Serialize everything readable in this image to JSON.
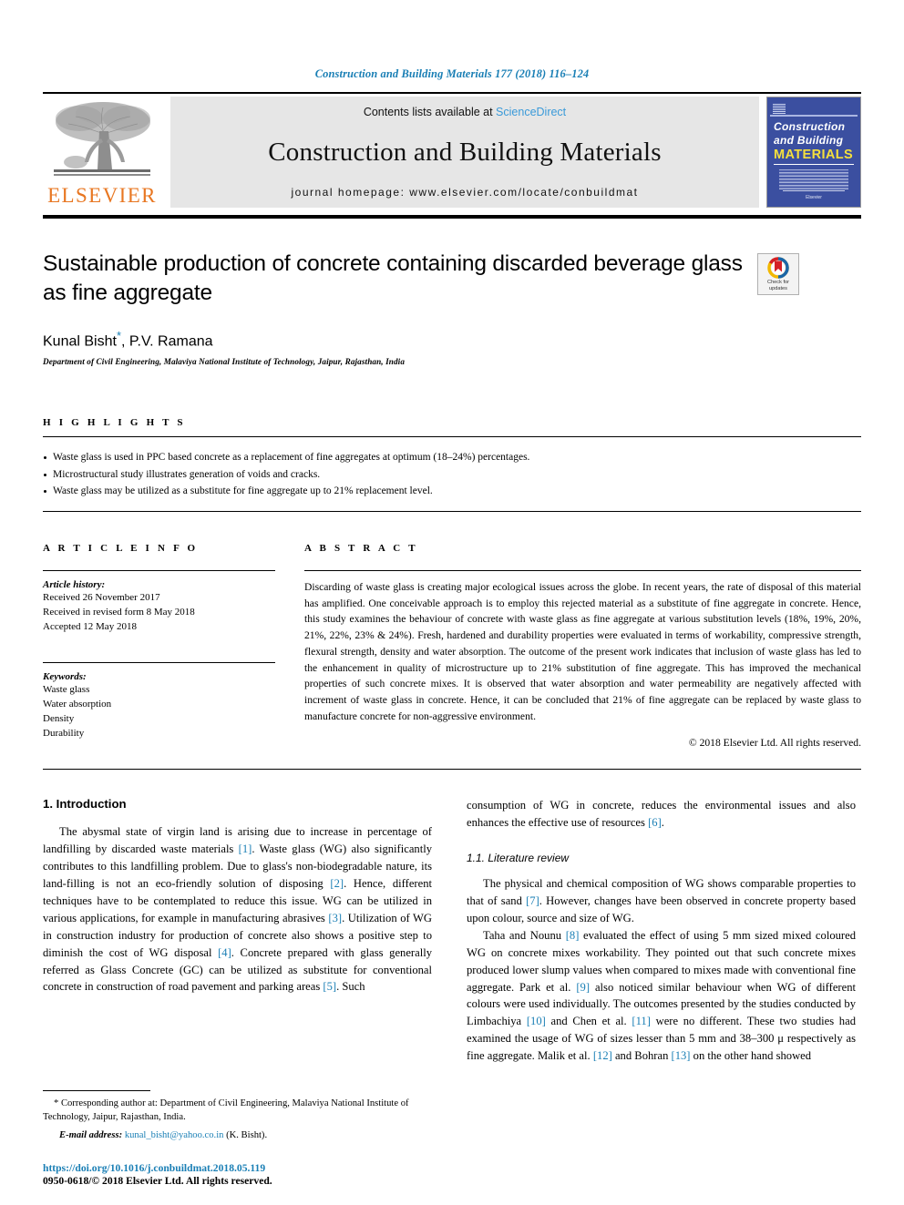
{
  "running_head": "Construction and Building Materials 177 (2018) 116–124",
  "masthead": {
    "publisher_logo_name": "ELSEVIER",
    "contents_prefix": "Contents lists available at ",
    "contents_link": "ScienceDirect",
    "journal_name": "Construction and Building Materials",
    "homepage": "journal homepage: www.elsevier.com/locate/conbuildmat",
    "cover": {
      "line1": "Construction",
      "line2": "and Building",
      "line3": "MATERIALS",
      "footer": "Elsevier"
    }
  },
  "article": {
    "title": "Sustainable production of concrete containing discarded beverage glass as fine aggregate",
    "authors": "Kunal Bisht",
    "authors_rest": ", P.V. Ramana",
    "corresponding_marker": "*",
    "affiliation": "Department of Civil Engineering, Malaviya National Institute of Technology, Jaipur, Rajasthan, India",
    "crossmark_line1": "Check for",
    "crossmark_line2": "updates"
  },
  "highlights": {
    "label": "H I G H L I G H T S",
    "items": [
      "Waste glass is used in PPC based concrete as a replacement of fine aggregates at optimum (18–24%) percentages.",
      "Microstructural study illustrates generation of voids and cracks.",
      "Waste glass may be utilized as a substitute for fine aggregate up to 21% replacement level."
    ]
  },
  "article_info": {
    "label": "A R T I C L E    I N F O",
    "history_title": "Article history:",
    "history": [
      "Received 26 November 2017",
      "Received in revised form 8 May 2018",
      "Accepted 12 May 2018"
    ],
    "keywords_title": "Keywords:",
    "keywords": [
      "Waste glass",
      "Water absorption",
      "Density",
      "Durability"
    ]
  },
  "abstract": {
    "label": "A B S T R A C T",
    "body": "Discarding of waste glass is creating major ecological issues across the globe. In recent years, the rate of disposal of this material has amplified. One conceivable approach is to employ this rejected material as a substitute of fine aggregate in concrete. Hence, this study examines the behaviour of concrete with waste glass as fine aggregate at various substitution levels (18%, 19%, 20%, 21%, 22%, 23% & 24%). Fresh, hardened and durability properties were evaluated in terms of workability, compressive strength, flexural strength, density and water absorption. The outcome of the present work indicates that inclusion of waste glass has led to the enhancement in quality of microstructure up to 21% substitution of fine aggregate. This has improved the mechanical properties of such concrete mixes. It is observed that water absorption and water permeability are negatively affected with increment of waste glass in concrete. Hence, it can be concluded that 21% of fine aggregate can be replaced by waste glass to manufacture concrete for non-aggressive environment.",
    "copyright": "© 2018 Elsevier Ltd. All rights reserved."
  },
  "body": {
    "section1_heading": "1. Introduction",
    "left_para1_a": "The abysmal state of virgin land is arising due to increase in percentage of landfilling by discarded waste materials ",
    "ref1": "[1]",
    "left_para1_b": ". Waste glass (WG) also significantly contributes to this landfilling problem. Due to glass's non-biodegradable nature, its land-filling is not an eco-friendly solution of disposing ",
    "ref2": "[2]",
    "left_para1_c": ". Hence, different techniques have to be contemplated to reduce this issue. WG can be utilized in various applications, for example in manufacturing abrasives ",
    "ref3": "[3]",
    "left_para1_d": ". Utilization of WG in construction industry for production of concrete also shows a positive step to diminish the cost of WG disposal ",
    "ref4": "[4]",
    "left_para1_e": ". Concrete prepared with glass generally referred as Glass Concrete (GC) can be utilized as substitute for conventional concrete in construction of road pavement and parking areas ",
    "ref5": "[5]",
    "left_para1_f": ". Such",
    "right_para_cont_a": "consumption of WG in concrete, reduces the environmental issues and also enhances the effective use of resources ",
    "ref6": "[6]",
    "right_para_cont_b": ".",
    "subsection_heading": "1.1. Literature review",
    "right_para2_a": "The physical and chemical composition of WG shows comparable properties to that of sand ",
    "ref7": "[7]",
    "right_para2_b": ". However, changes have been observed in concrete property based upon colour, source and size of WG.",
    "right_para3_a": "Taha and Nounu ",
    "ref8": "[8]",
    "right_para3_b": " evaluated the effect of using 5 mm sized mixed coloured WG on concrete mixes workability. They pointed out that such concrete mixes produced lower slump values when compared to mixes made with conventional fine aggregate. Park et al. ",
    "ref9": "[9]",
    "right_para3_c": " also noticed similar behaviour when WG of different colours were used individually. The outcomes presented by the studies conducted by Limbachiya ",
    "ref10": "[10]",
    "right_para3_d": " and Chen et al. ",
    "ref11": "[11]",
    "right_para3_e": " were no different. These two studies had examined the usage of WG of sizes lesser than 5 mm and 38–300 μ respectively as fine aggregate. Malik et al. ",
    "ref12": "[12]",
    "right_para3_f": " and Bohran ",
    "ref13": "[13]",
    "right_para3_g": " on the other hand showed"
  },
  "footnotes": {
    "corresponding": "* Corresponding author at: Department of Civil Engineering, Malaviya National Institute of Technology, Jaipur, Rajasthan, India.",
    "email_label": "E-mail address:",
    "email": "kunal_bisht@yahoo.co.in",
    "email_suffix": " (K. Bisht).",
    "doi": "https://doi.org/10.1016/j.conbuildmat.2018.05.119",
    "issn": "0950-0618/© 2018 Elsevier Ltd. All rights reserved."
  },
  "colors": {
    "link_blue": "#1a7fb5",
    "sciencedirect_blue": "#3a9ad9",
    "elsevier_orange": "#E87722",
    "masthead_grey": "#e6e6e6",
    "cover_blue": "#3b4fa0"
  }
}
